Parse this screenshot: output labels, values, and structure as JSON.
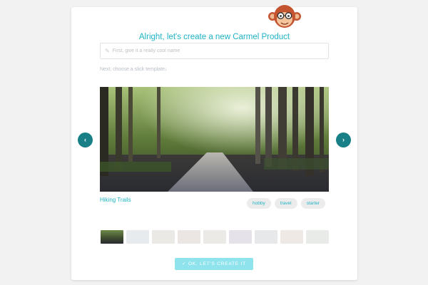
{
  "header": {
    "title": "Alright, let's create a new Carmel Product",
    "mascot": "monkey-with-glasses-logo"
  },
  "form": {
    "name_placeholder": "First, give it a really cool name",
    "name_value": "",
    "pencil_icon": "pencil-icon",
    "template_hint": "Next, choose a slick template↓"
  },
  "carousel": {
    "prev_icon": "chevron-left-icon",
    "next_icon": "chevron-right-icon",
    "accent": "#177f85",
    "selected": {
      "name": "Hiking Trails",
      "tags": [
        "hobby",
        "travel",
        "starter"
      ]
    },
    "thumbnails": [
      {
        "name": "hiking-trails",
        "selected": true,
        "color": "#3c4a2e"
      },
      {
        "name": "template-2",
        "selected": false,
        "color": "#dfe4e8"
      },
      {
        "name": "template-3",
        "selected": false,
        "color": "#e3e2dc"
      },
      {
        "name": "template-4",
        "selected": false,
        "color": "#e4dcd9"
      },
      {
        "name": "template-5",
        "selected": false,
        "color": "#e6e3df"
      },
      {
        "name": "template-6",
        "selected": false,
        "color": "#dcdae2"
      },
      {
        "name": "template-7",
        "selected": false,
        "color": "#dde0e2"
      },
      {
        "name": "template-8",
        "selected": false,
        "color": "#eae2dc"
      },
      {
        "name": "template-9",
        "selected": false,
        "color": "#e1e4e2"
      }
    ]
  },
  "actions": {
    "create_label": "OK, LET'S CREATE IT",
    "create_color": "#8fe3ec"
  }
}
